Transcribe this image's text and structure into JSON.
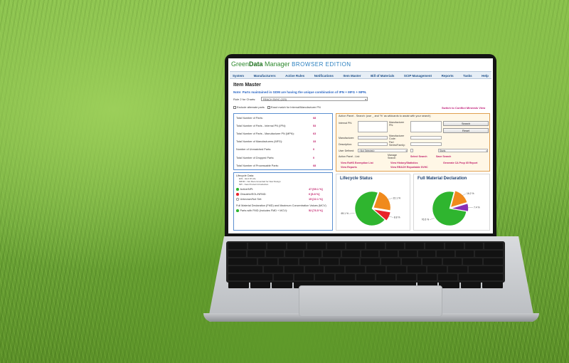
{
  "app": {
    "logo_part1": "Green",
    "logo_part2": "Data",
    "logo_part3": " Manager ",
    "edition": "BROWSER EDITION"
  },
  "nav": [
    "System",
    "Manufacturers",
    "Active Rules",
    "Notifications",
    "Item Master",
    "Bill of Materials",
    "SCIP Management",
    "Reports",
    "Tasks",
    "Help"
  ],
  "page": {
    "title": "Item Master",
    "note": "Note: Parts maintained in GDM are having the unique combination of IPN + MFG + MPN.",
    "rule_label": "Rule 2 for Charts:",
    "rule_value": "REACH SVHC (223)",
    "exclude_alt": "Exclude alternate parts",
    "exact_match": "Exact match for Internal/Manufacturer PN",
    "switch_link": "Switch to Conflict Minerals View"
  },
  "stats": [
    {
      "label": "Total Number of Parts:",
      "value": "68"
    },
    {
      "label": "Total Number of Parts - Internal PN (IPN):",
      "value": "53"
    },
    {
      "label": "Total Number of Parts - Manufacturer PN (MPN):",
      "value": "63"
    },
    {
      "label": "Total Number of Manufacturers (MFG):",
      "value": "33"
    },
    {
      "label": "Number of Unmatched Parts:",
      "value": "0"
    },
    {
      "label": "Total Number of Dropped Parts:",
      "value": "0"
    },
    {
      "label": "Total Number of Processable Parts:",
      "value": "68"
    }
  ],
  "lifecycle": {
    "heading": "Lifecycle Data:",
    "legend1": "EOL - End Of Life",
    "legend2": "NRND - Not Recommended for New Design",
    "legend3": "NPI - New Product Introduction",
    "active_label": "Active/NPI:",
    "active_value": "47 [69.1 %]",
    "obsolete_label": "Obsolete/EOL/NRND:",
    "obsolete_value": "6 [8.8 %]",
    "unknown_label": "Unknown/Not Set:",
    "unknown_value": "15 [22.1 %]",
    "fmd_heading": "Full Material Declaration (FMD) and Maximum Concentration Values (MCV)",
    "fmd_label": "Parts with FMD (includes FMD + MCV):",
    "fmd_value": "52 [76.5 %]"
  },
  "action": {
    "heading": "Action Panel - Search: (use _ and '%' as wildcards to assist with your search)",
    "internal_pn": "Internal PN:",
    "manufacturer_pn": "Manufacturer PN:",
    "manufacturer": "Manufacturer:",
    "manufacturer_code": "Manufacturer Code:",
    "description": "Description:",
    "part_series": "Part Series/Family:",
    "user_defined": "User Defined:",
    "not_selected": "<Not Selected>",
    "starts": "Starts",
    "search_btn": "Search",
    "reset_btn": "Reset",
    "list_label": "Action Panel - List:",
    "manage_search": "Manage Search",
    "select_search": "Select Search",
    "save_search": "Save Search",
    "link1": "View RoHS Exemption List",
    "link2": "View History/Statistics",
    "link3": "Generate CA Prop 65 Report",
    "link4": "View Reports",
    "link5": "View REACH Reportable SVHC"
  },
  "charts": {
    "lifecycle_title": "Lifecycle Status",
    "fmd_title": "Full Material Declaration"
  },
  "chart_data": [
    {
      "type": "pie",
      "title": "Lifecycle Status",
      "labels": [
        "69.1 %",
        "8.8 %",
        "22.1 %"
      ],
      "values": [
        69.1,
        8.8,
        22.1
      ],
      "colors": [
        "#2fb52f",
        "#e8232a",
        "#f08a1c"
      ]
    },
    {
      "type": "pie",
      "title": "Full Material Declaration",
      "labels": [
        "76.5 %",
        "7.4 %",
        "16.2 %"
      ],
      "values": [
        76.5,
        7.4,
        16.2
      ],
      "colors": [
        "#2fb52f",
        "#8a2fb5",
        "#f08a1c"
      ]
    }
  ]
}
